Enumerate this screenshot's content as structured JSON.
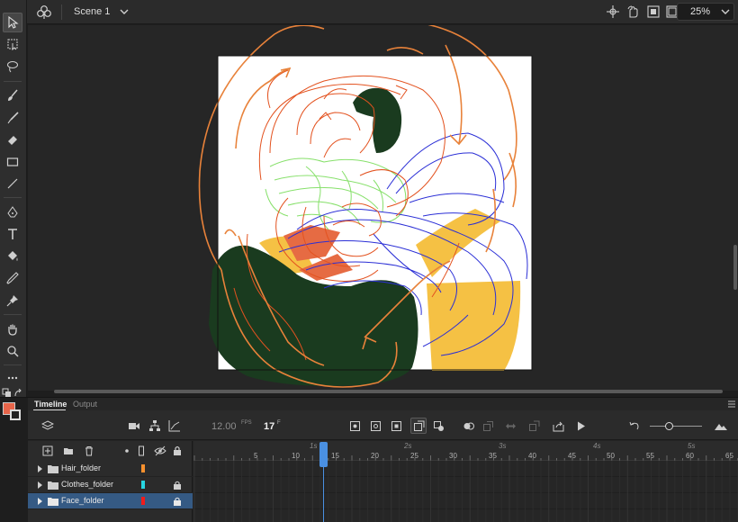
{
  "header": {
    "scene_label": "Scene 1",
    "zoom_value": "25%"
  },
  "colors": {
    "fill_color": "#e8654a",
    "stroke_color": "#222222",
    "stage_background": "#ffffff",
    "pasteboard": "#262626",
    "selected_layer": "#355a84",
    "playhead": "#4a90e2",
    "sketch_red": "#e3521f",
    "sketch_orange": "#e8823a",
    "sketch_blue": "#2b2fd6",
    "sketch_green": "#86e06a",
    "shape_dark_green": "#1a3b1f",
    "shape_yellow": "#f5c144",
    "shape_coral": "#e66b43"
  },
  "tools": [
    {
      "name": "selection-tool",
      "icon": "arrow-icon",
      "active": true
    },
    {
      "name": "free-transform-tool",
      "icon": "free-transform-icon"
    },
    {
      "name": "lasso-tool",
      "icon": "lasso-icon"
    },
    {
      "name": "brush-tool",
      "icon": "brush-icon"
    },
    {
      "name": "paint-brush-tool",
      "icon": "paint-brush-icon"
    },
    {
      "name": "eraser-tool",
      "icon": "eraser-icon"
    },
    {
      "name": "rectangle-tool",
      "icon": "rectangle-icon"
    },
    {
      "name": "line-tool",
      "icon": "line-icon"
    },
    {
      "name": "pen-tool",
      "icon": "pen-icon"
    },
    {
      "name": "text-tool",
      "icon": "text-icon"
    },
    {
      "name": "paint-bucket-tool",
      "icon": "paint-bucket-icon"
    },
    {
      "name": "eyedropper-tool",
      "icon": "eyedropper-icon"
    },
    {
      "name": "pin-tool",
      "icon": "pin-icon"
    },
    {
      "name": "hand-tool",
      "icon": "hand-icon"
    },
    {
      "name": "zoom-tool",
      "icon": "magnifier-icon"
    },
    {
      "name": "more-tools",
      "icon": "ellipsis-icon"
    }
  ],
  "panel": {
    "tabs": [
      "Timeline",
      "Output"
    ]
  },
  "timeline": {
    "fps_value": "12.00",
    "fps_unit": "FPS",
    "current_frame": "17",
    "frame_unit": "F",
    "seconds_labels": [
      "1s",
      "2s",
      "3s",
      "4s",
      "5s"
    ],
    "frame_numbers": [
      "5",
      "10",
      "15",
      "20",
      "25",
      "30",
      "35",
      "40",
      "45",
      "50",
      "55",
      "60",
      "65"
    ]
  },
  "layers": [
    {
      "name": "Hair_folder",
      "color": "#f7902e",
      "locked": false,
      "selected": false
    },
    {
      "name": "Clothes_folder",
      "color": "#27d6e2",
      "locked": true,
      "selected": false
    },
    {
      "name": "Face_folder",
      "color": "#f21b1b",
      "locked": true,
      "selected": true
    }
  ]
}
